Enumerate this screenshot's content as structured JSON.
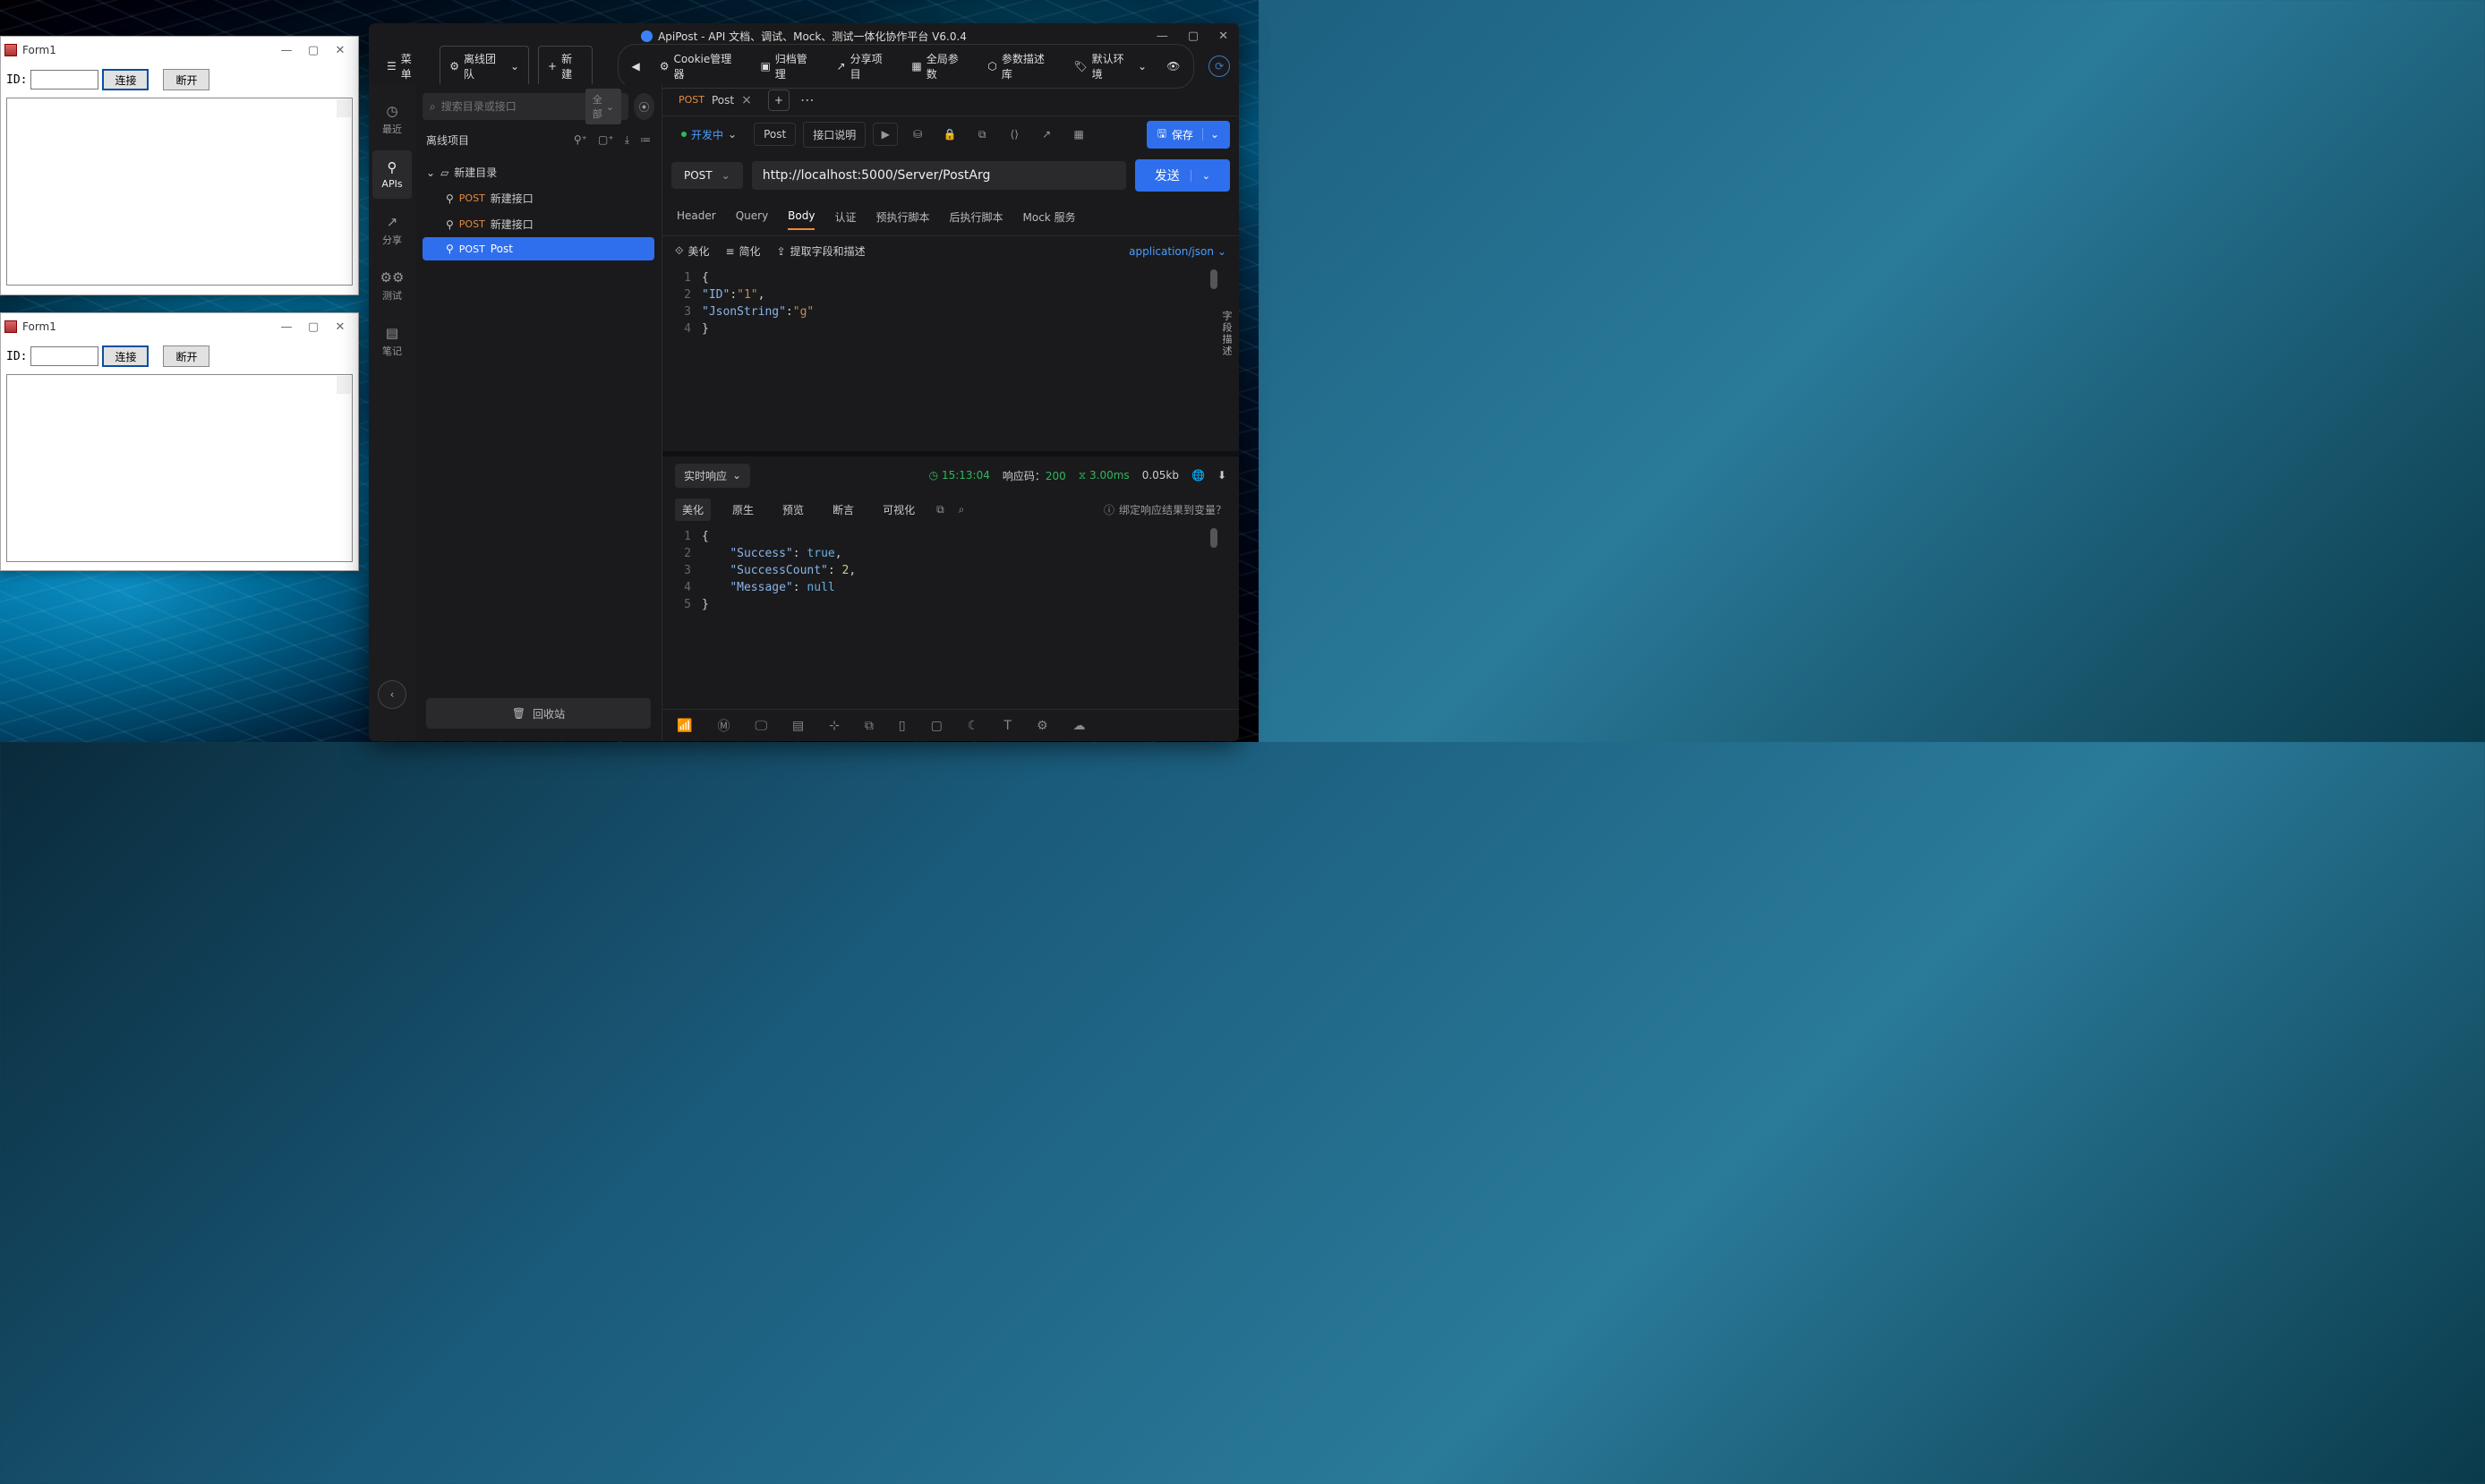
{
  "form_windows": [
    {
      "title": "Form1",
      "id_label": "ID:",
      "connect": "连接",
      "disconnect": "断开"
    },
    {
      "title": "Form1",
      "id_label": "ID:",
      "connect": "连接",
      "disconnect": "断开"
    }
  ],
  "apipost": {
    "title": "ApiPost - API 文档、调试、Mock、测试一体化协作平台 V6.0.4",
    "toolbar": {
      "menu": "菜单",
      "team": "离线团队",
      "new": "新建",
      "back": "◀",
      "cookie": "Cookie管理器",
      "archive": "归档管理",
      "share": "分享项目",
      "global": "全局参数",
      "desc": "参数描述库",
      "env": "默认环境"
    },
    "leftnav": [
      {
        "label": "最近",
        "icon": "clock"
      },
      {
        "label": "APIs",
        "icon": "api"
      },
      {
        "label": "分享",
        "icon": "share"
      },
      {
        "label": "测试",
        "icon": "test"
      },
      {
        "label": "笔记",
        "icon": "note"
      }
    ],
    "sidebar": {
      "search_placeholder": "搜索目录或接口",
      "search_scope": "全部",
      "project": "离线项目",
      "folder": "新建目录",
      "items": [
        {
          "method": "POST",
          "name": "新建接口"
        },
        {
          "method": "POST",
          "name": "新建接口"
        },
        {
          "method": "POST",
          "name": "Post",
          "selected": true
        }
      ],
      "recycle": "回收站"
    },
    "main": {
      "tab": {
        "method": "POST",
        "name": "Post"
      },
      "action": {
        "status": "开发中",
        "post_label": "Post",
        "doc": "接口说明",
        "save": "保存"
      },
      "method": "POST",
      "url": "http://localhost:5000/Server/PostArg",
      "send": "发送",
      "req_tabs": [
        "Header",
        "Query",
        "Body",
        "认证",
        "预执行脚本",
        "后执行脚本",
        "Mock 服务"
      ],
      "req_tab_active": 2,
      "body_tools": {
        "beautify": "美化",
        "simplify": "简化",
        "extract": "提取字段和描述"
      },
      "content_type": "application/json",
      "side_label": "字段描述",
      "body_lines": [
        "{",
        "\"ID\":\"1\",",
        "\"JsonString\":\"g\"",
        "}"
      ],
      "body_json": {
        "ID": "1",
        "JsonString": "g"
      },
      "response": {
        "mode": "实时响应",
        "time": "15:13:04",
        "status_label": "响应码：",
        "status": "200",
        "duration": "3.00ms",
        "size": "0.05kb",
        "tabs": [
          "美化",
          "原生",
          "预览",
          "断言",
          "可视化"
        ],
        "tab_active": 0,
        "bind": "绑定响应结果到变量？",
        "body_json": {
          "Success": true,
          "SuccessCount": 2,
          "Message": null
        }
      }
    }
  }
}
